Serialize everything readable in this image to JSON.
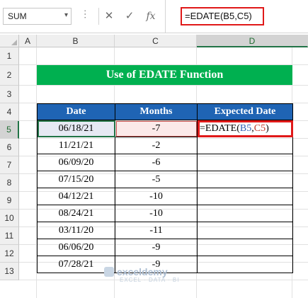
{
  "formula_bar": {
    "name_box": "SUM",
    "cancel_icon": "✕",
    "enter_icon": "✓",
    "function_icon": "fx",
    "formula": "=EDATE(B5,C5)"
  },
  "columns": [
    "A",
    "B",
    "C",
    "D"
  ],
  "selected_column": "D",
  "rows": [
    "1",
    "2",
    "3",
    "4",
    "5",
    "6",
    "7",
    "8",
    "9",
    "10",
    "11",
    "12",
    "13"
  ],
  "selected_row": "5",
  "title": "Use of EDATE Function",
  "table": {
    "headers": [
      "Date",
      "Months",
      "Expected Date"
    ],
    "rows": [
      {
        "date": "06/18/21",
        "months": "-7"
      },
      {
        "date": "11/21/21",
        "months": "-2"
      },
      {
        "date": "06/09/20",
        "months": "-6"
      },
      {
        "date": "07/15/20",
        "months": "-5"
      },
      {
        "date": "04/12/21",
        "months": "-10"
      },
      {
        "date": "08/24/21",
        "months": "-10"
      },
      {
        "date": "03/11/20",
        "months": "-11"
      },
      {
        "date": "06/06/20",
        "months": "-9"
      },
      {
        "date": "07/28/21",
        "months": "-9"
      }
    ],
    "editing_cell": {
      "prefix": "=EDATE(",
      "ref1": "B5",
      "sep": ",",
      "ref2": "C5",
      "suffix": ")"
    }
  },
  "watermark": {
    "name": "exceldemy",
    "tagline": "EXCEL · DATA · BI"
  },
  "colors": {
    "header_blue": "#1f64b4",
    "title_green": "#00b050",
    "highlight_red": "#e01919",
    "select_green": "#217346"
  }
}
